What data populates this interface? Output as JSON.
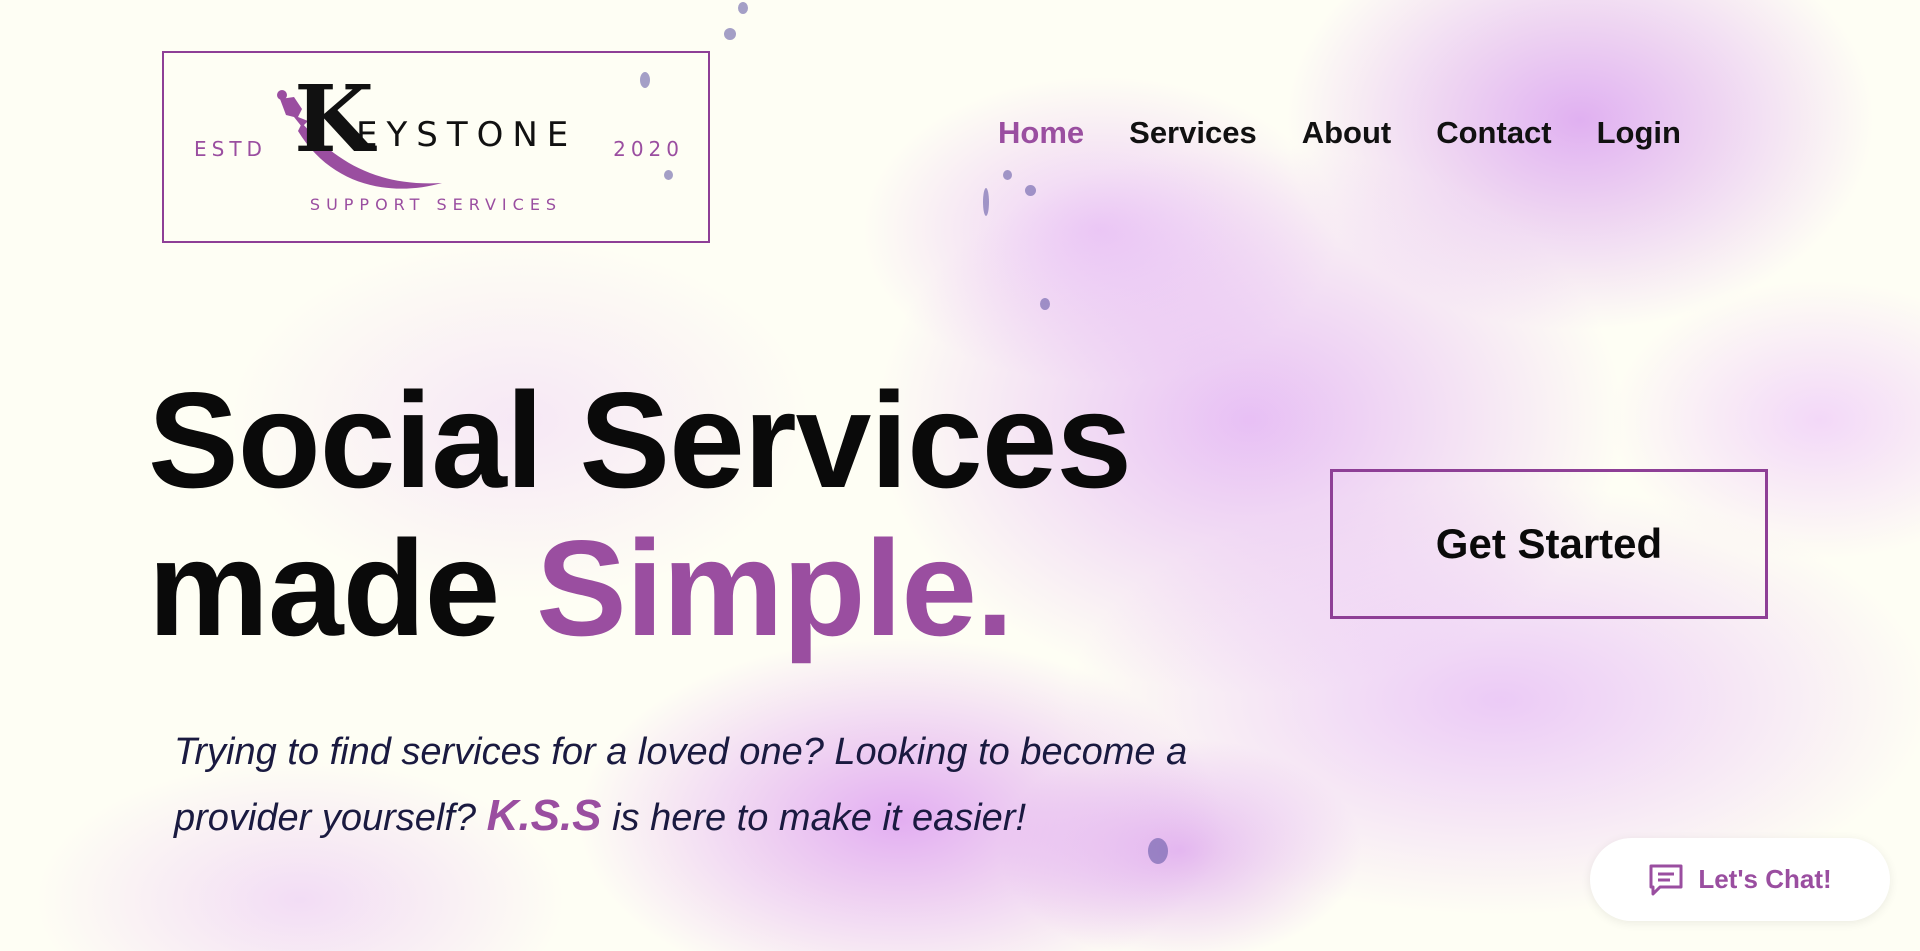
{
  "logo": {
    "estd": "ESTD",
    "year": "2020",
    "letter": "K",
    "word": "EYSTONE",
    "subtitle": "SUPPORT SERVICES"
  },
  "nav": {
    "items": [
      {
        "label": "Home",
        "active": true
      },
      {
        "label": "Services",
        "active": false
      },
      {
        "label": "About",
        "active": false
      },
      {
        "label": "Contact",
        "active": false
      },
      {
        "label": "Login",
        "active": false
      }
    ]
  },
  "hero": {
    "line1": "Social Services",
    "line2_prefix": "made ",
    "line2_accent": "Simple.",
    "tagline_part1": "Trying to find services for a loved one? Looking to become a provider yourself? ",
    "tagline_brand": "K.S.S",
    "tagline_part2": " is here to make it easier!"
  },
  "cta": {
    "label": "Get Started"
  },
  "chat": {
    "label": "Let's Chat!",
    "icon": "chat-bubble-icon"
  },
  "colors": {
    "accent": "#9a4ea0",
    "background": "#fefef4",
    "text": "#0a0a0a"
  }
}
